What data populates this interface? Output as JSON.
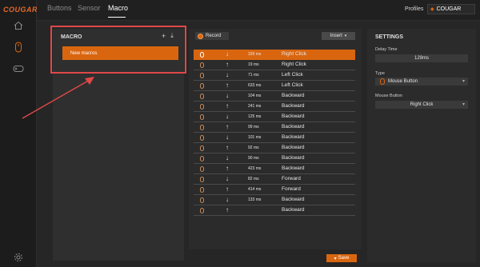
{
  "brand": {
    "logo": "COUGAR",
    "accent": "#d9660f"
  },
  "tabs": [
    {
      "label": "Buttons"
    },
    {
      "label": "Sensor"
    },
    {
      "label": "Macro"
    }
  ],
  "profiles": {
    "label": "Profiles",
    "selected": "COUGAR"
  },
  "macro_panel": {
    "title": "MACRO",
    "add_icon": "plus-icon",
    "import_icon": "download-icon",
    "items": [
      {
        "label": "New macros"
      }
    ]
  },
  "toolbar": {
    "record_label": "Record",
    "insert_label": "Insert"
  },
  "events": [
    {
      "dir": "↓",
      "ms": "339 ms",
      "action": "Right Click"
    },
    {
      "dir": "↑",
      "ms": "19 ms",
      "action": "Right Click"
    },
    {
      "dir": "↓",
      "ms": "71 ms",
      "action": "Left Click"
    },
    {
      "dir": "↑",
      "ms": "633 ms",
      "action": "Left Click"
    },
    {
      "dir": "↓",
      "ms": "104 ms",
      "action": "Backward"
    },
    {
      "dir": "↑",
      "ms": "241 ms",
      "action": "Backward"
    },
    {
      "dir": "↓",
      "ms": "125 ms",
      "action": "Backward"
    },
    {
      "dir": "↑",
      "ms": "99 ms",
      "action": "Backward"
    },
    {
      "dir": "↓",
      "ms": "101 ms",
      "action": "Backward"
    },
    {
      "dir": "↑",
      "ms": "92 ms",
      "action": "Backward"
    },
    {
      "dir": "↓",
      "ms": "90 ms",
      "action": "Backward"
    },
    {
      "dir": "↑",
      "ms": "423 ms",
      "action": "Backward"
    },
    {
      "dir": "↓",
      "ms": "82 ms",
      "action": "Forward"
    },
    {
      "dir": "↑",
      "ms": "414 ms",
      "action": "Forward"
    },
    {
      "dir": "↓",
      "ms": "133 ms",
      "action": "Backward"
    },
    {
      "dir": "↑",
      "ms": "",
      "action": "Backward"
    }
  ],
  "save_label": "Save",
  "settings": {
    "title": "SETTINGS",
    "delay_label": "Delay Time",
    "delay_value": "129ms",
    "type_label": "Type",
    "type_value": "Mouse Button",
    "mouse_button_label": "Mouse Button",
    "mouse_button_value": "Right Click"
  }
}
